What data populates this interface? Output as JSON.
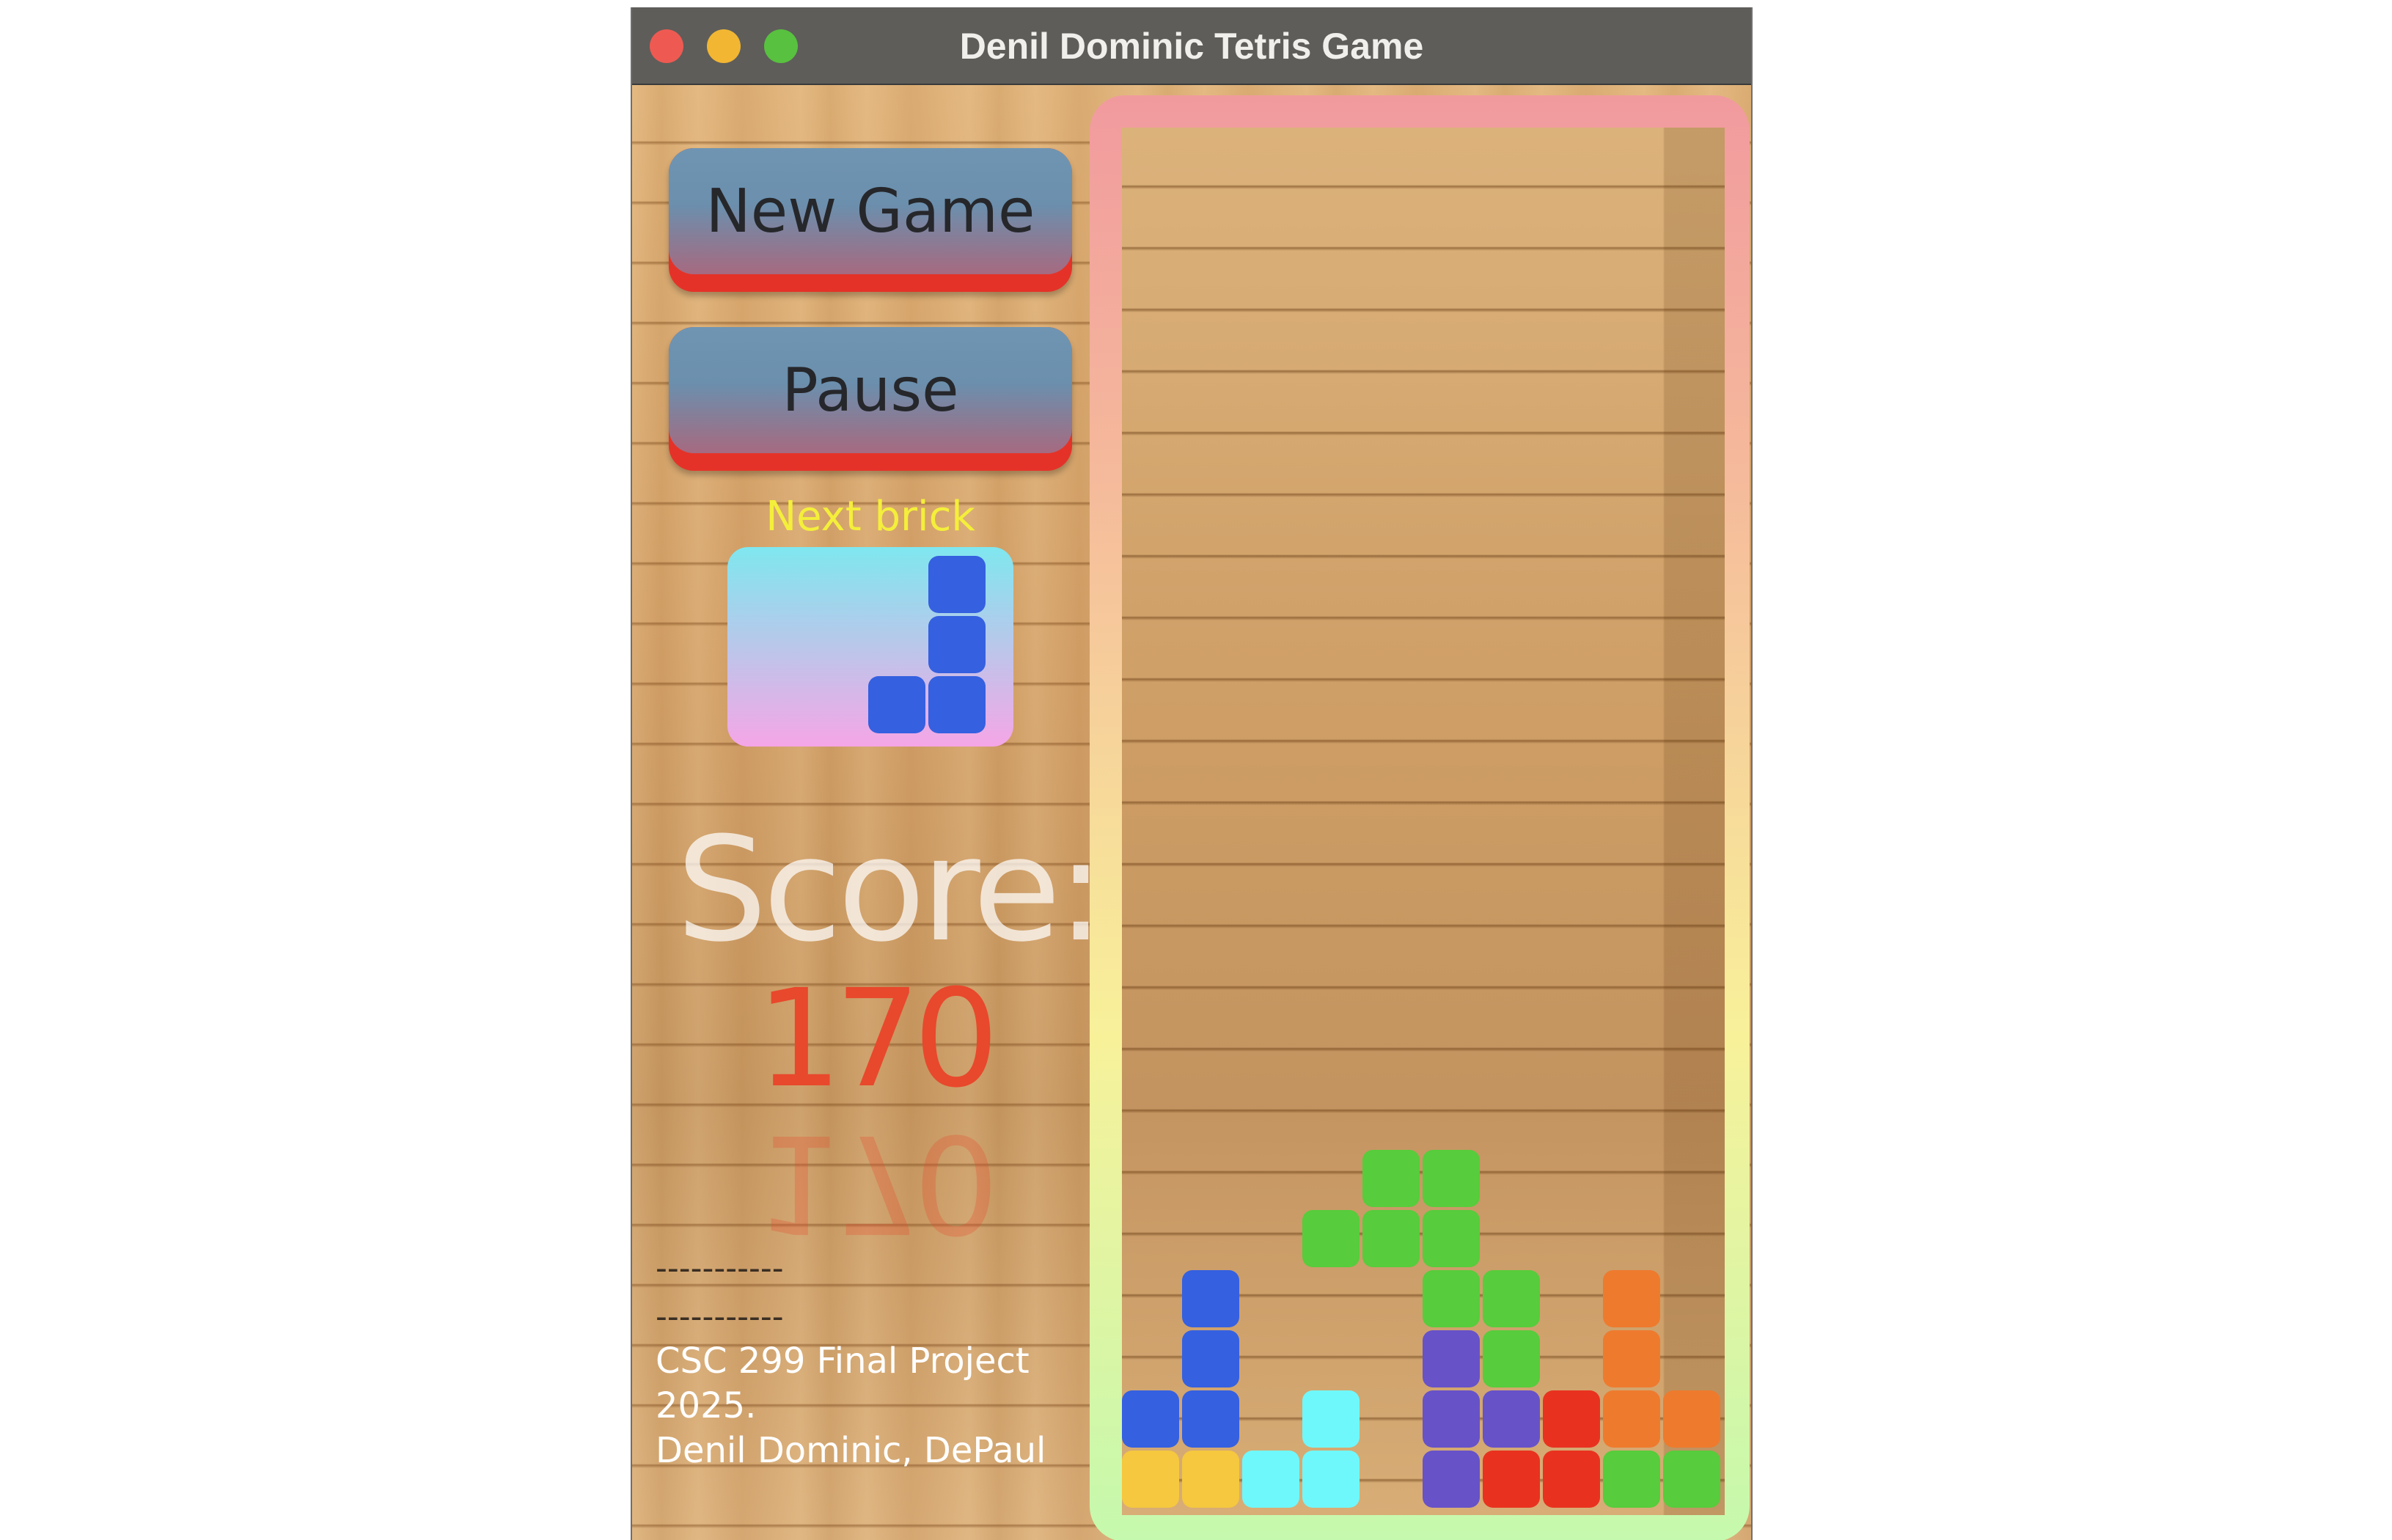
{
  "window": {
    "title": "Denil Dominic Tetris Game"
  },
  "controls": {
    "new_game_label": "New Game",
    "pause_label": "Pause"
  },
  "next_brick": {
    "label": "Next brick",
    "color": "#3560e0",
    "cells": [
      [
        2,
        0
      ],
      [
        2,
        1
      ],
      [
        1,
        2
      ],
      [
        2,
        2
      ]
    ]
  },
  "score": {
    "label": "Score:",
    "value": "170"
  },
  "footer": {
    "dashes_1": "-----------",
    "dashes_2": "-----------",
    "line_1": "CSC 299 Final Project",
    "line_2": "2025.",
    "line_3": "Denil Dominic, DePaul"
  },
  "colors": {
    "blue": "#3560e0",
    "green": "#57cc3c",
    "purple": "#6752c8",
    "orange": "#ee7a2e",
    "red": "#e8321f",
    "cyan": "#6ff8fb",
    "yellow": "#f5c83f"
  },
  "board": {
    "columns": 10,
    "rows": 24,
    "cells": [
      {
        "c": 4,
        "r": 18,
        "color": "green"
      },
      {
        "c": 5,
        "r": 18,
        "color": "green"
      },
      {
        "c": 3,
        "r": 19,
        "color": "green"
      },
      {
        "c": 4,
        "r": 19,
        "color": "green"
      },
      {
        "c": 5,
        "r": 19,
        "color": "green"
      },
      {
        "c": 1,
        "r": 20,
        "color": "blue"
      },
      {
        "c": 5,
        "r": 20,
        "color": "green"
      },
      {
        "c": 6,
        "r": 20,
        "color": "green"
      },
      {
        "c": 8,
        "r": 20,
        "color": "orange"
      },
      {
        "c": 1,
        "r": 21,
        "color": "blue"
      },
      {
        "c": 5,
        "r": 21,
        "color": "purple"
      },
      {
        "c": 6,
        "r": 21,
        "color": "green"
      },
      {
        "c": 8,
        "r": 21,
        "color": "orange"
      },
      {
        "c": 0,
        "r": 22,
        "color": "blue"
      },
      {
        "c": 1,
        "r": 22,
        "color": "blue"
      },
      {
        "c": 3,
        "r": 22,
        "color": "cyan"
      },
      {
        "c": 5,
        "r": 22,
        "color": "purple"
      },
      {
        "c": 6,
        "r": 22,
        "color": "purple"
      },
      {
        "c": 7,
        "r": 22,
        "color": "red"
      },
      {
        "c": 8,
        "r": 22,
        "color": "orange"
      },
      {
        "c": 9,
        "r": 22,
        "color": "orange"
      },
      {
        "c": 0,
        "r": 23,
        "color": "yellow"
      },
      {
        "c": 1,
        "r": 23,
        "color": "yellow"
      },
      {
        "c": 2,
        "r": 23,
        "color": "cyan"
      },
      {
        "c": 3,
        "r": 23,
        "color": "cyan"
      },
      {
        "c": 5,
        "r": 23,
        "color": "purple"
      },
      {
        "c": 6,
        "r": 23,
        "color": "red"
      },
      {
        "c": 7,
        "r": 23,
        "color": "red"
      },
      {
        "c": 8,
        "r": 23,
        "color": "green"
      },
      {
        "c": 9,
        "r": 23,
        "color": "green"
      }
    ]
  }
}
